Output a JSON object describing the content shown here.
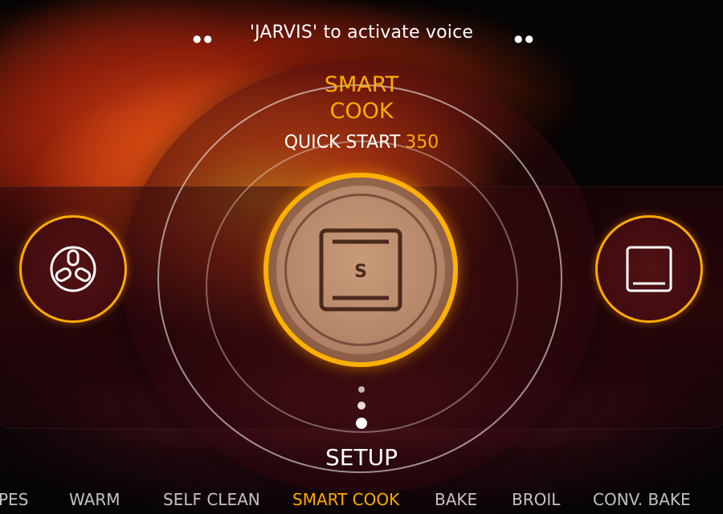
{
  "voice_prompt": "'JARVIS' to activate voice",
  "current_mode": {
    "title_line1": "SMART",
    "title_line2": "COOK",
    "quick_start_label": "QUICK START",
    "quick_start_temp": "350",
    "center_icon_letter": "S"
  },
  "setup_label": "SETUP",
  "mode_bar": [
    {
      "label": "PES",
      "active": false
    },
    {
      "label": "WARM",
      "active": false
    },
    {
      "label": "SELF CLEAN",
      "active": false
    },
    {
      "label": "SMART COOK",
      "active": true
    },
    {
      "label": "BAKE",
      "active": false
    },
    {
      "label": "BROIL",
      "active": false
    },
    {
      "label": "CONV. BAKE",
      "active": false
    }
  ],
  "icons": {
    "left": "convection-fan-icon",
    "center": "smart-cook-oven-icon",
    "right": "bake-oven-icon"
  },
  "colors": {
    "accent": "#ffab00",
    "text": "#ffffff"
  }
}
